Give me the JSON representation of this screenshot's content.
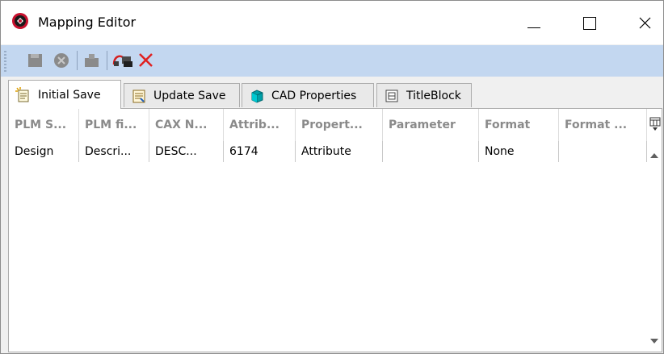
{
  "window": {
    "title": "Mapping Editor",
    "icons": {
      "app": "red-gear-app-icon",
      "minimize": "minimize-icon",
      "maximize": "maximize-icon",
      "close": "close-icon"
    }
  },
  "toolbar": {
    "buttons": [
      {
        "name": "save-icon",
        "enabled": false
      },
      {
        "name": "cancel-icon",
        "enabled": false
      },
      {
        "name": "export-icon",
        "enabled": false
      },
      {
        "name": "map-attribute-icon",
        "enabled": true
      },
      {
        "name": "delete-icon",
        "enabled": true
      }
    ]
  },
  "tabs": [
    {
      "label": "Initial Save",
      "active": true,
      "icon": "new-document-icon"
    },
    {
      "label": "Update Save",
      "active": false,
      "icon": "update-document-icon"
    },
    {
      "label": "CAD Properties",
      "active": false,
      "icon": "cube-icon"
    },
    {
      "label": "TitleBlock",
      "active": false,
      "icon": "titleblock-icon"
    }
  ],
  "grid": {
    "columns": [
      "PLM S...",
      "PLM fi...",
      "CAX N...",
      "Attrib...",
      "Propert...",
      "Parameter",
      "Format",
      "Format ..."
    ],
    "rows": [
      [
        "Design",
        "Descri...",
        "DESC...",
        "6174",
        "Attribute",
        "",
        "None",
        ""
      ]
    ]
  },
  "colors": {
    "toolbar_bg": "#c3d7f0",
    "delete_red": "#e02020",
    "header_text": "#8a8a8a"
  }
}
